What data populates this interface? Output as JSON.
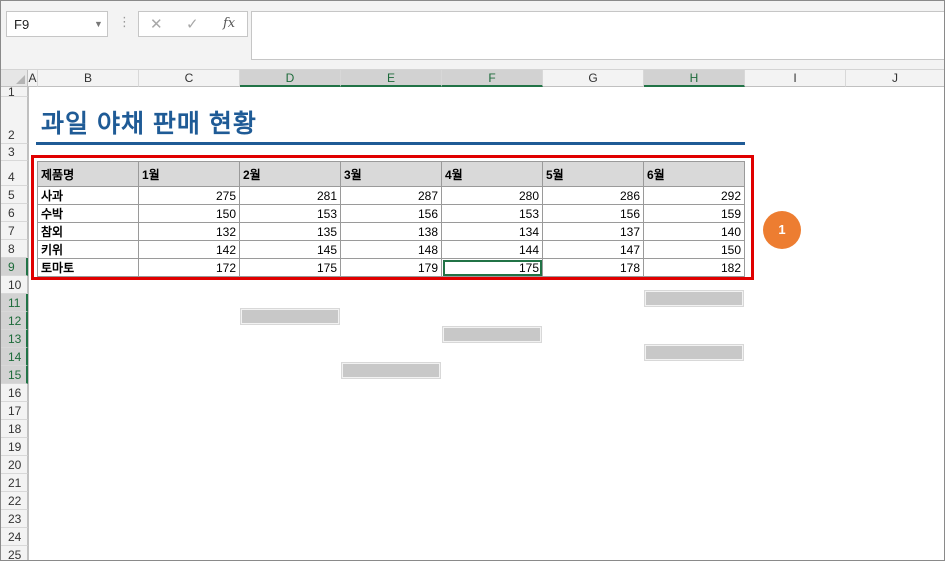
{
  "formula_bar": {
    "name_box": "F9",
    "dots": "⋮",
    "cancel": "✕",
    "enter": "✓",
    "fx": "fx",
    "value": ""
  },
  "columns": [
    "A",
    "B",
    "C",
    "D",
    "E",
    "F",
    "G",
    "H",
    "I",
    "J"
  ],
  "selected_columns": [
    "D",
    "E",
    "F",
    "H"
  ],
  "rows": [
    "1",
    "2",
    "3",
    "4",
    "5",
    "6",
    "7",
    "8",
    "9",
    "10",
    "11",
    "12",
    "13",
    "14",
    "15",
    "16",
    "17",
    "18",
    "19",
    "20",
    "21",
    "22",
    "23",
    "24",
    "25"
  ],
  "selected_rows": [
    "9",
    "11",
    "12",
    "13",
    "14",
    "15"
  ],
  "sheet": {
    "title": "과일 야채 판매 현황",
    "badge": "1",
    "table": {
      "headers": [
        "제품명",
        "1월",
        "2월",
        "3월",
        "4월",
        "5월",
        "6월"
      ],
      "rows": [
        {
          "name": "사과",
          "values": [
            "275",
            "281",
            "287",
            "280",
            "286",
            "292"
          ]
        },
        {
          "name": "수박",
          "values": [
            "150",
            "153",
            "156",
            "153",
            "156",
            "159"
          ]
        },
        {
          "name": "참외",
          "values": [
            "132",
            "135",
            "138",
            "134",
            "137",
            "140"
          ]
        },
        {
          "name": "키위",
          "values": [
            "142",
            "145",
            "148",
            "144",
            "147",
            "150"
          ]
        },
        {
          "name": "토마토",
          "values": [
            "172",
            "175",
            "179",
            "175",
            "178",
            "182"
          ]
        }
      ]
    }
  },
  "colors": {
    "title": "#1f5b96",
    "highlight_border": "#e00000",
    "badge": "#ed7d31",
    "selection": "#217346"
  }
}
